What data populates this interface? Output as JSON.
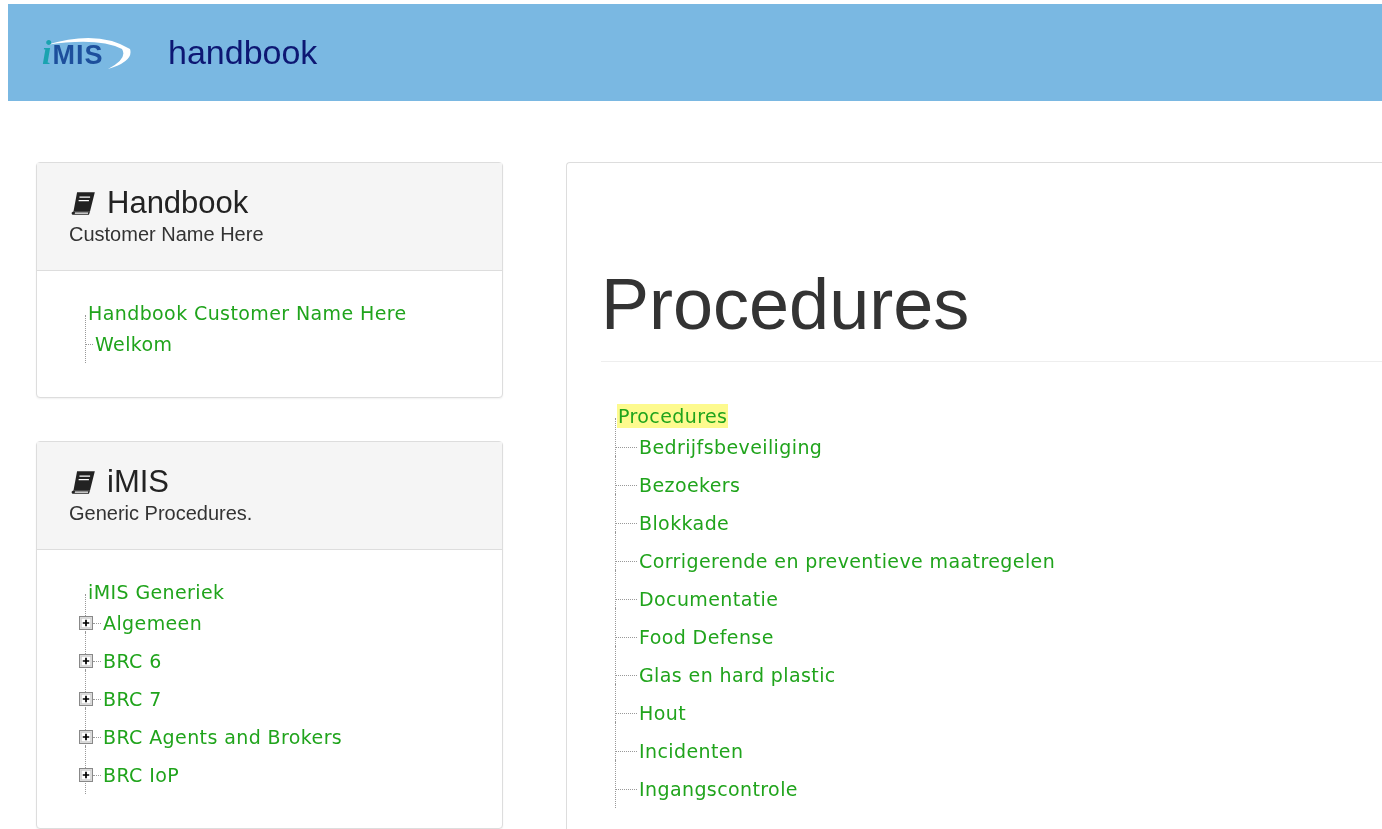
{
  "header": {
    "logo": "iMIS",
    "title": "handbook"
  },
  "panels": [
    {
      "title": "Handbook",
      "subtitle": "Customer Name Here",
      "tree": {
        "label": "Handbook Customer Name Here",
        "selected": false,
        "children": [
          {
            "label": "Welkom",
            "kind": "leaf",
            "selected": false
          }
        ]
      }
    },
    {
      "title": "iMIS",
      "subtitle": "Generic Procedures.",
      "tree": {
        "label": "iMIS Generiek",
        "selected": false,
        "children": [
          {
            "label": "Algemeen",
            "kind": "folder",
            "selected": false
          },
          {
            "label": "BRC 6",
            "kind": "folder",
            "selected": false
          },
          {
            "label": "BRC 7",
            "kind": "folder",
            "selected": false
          },
          {
            "label": "BRC Agents and Brokers",
            "kind": "folder",
            "selected": false
          },
          {
            "label": "BRC IoP",
            "kind": "folder",
            "selected": false
          }
        ]
      }
    }
  ],
  "main": {
    "heading": "Procedures",
    "tree": {
      "label": "Procedures",
      "selected": true,
      "children": [
        {
          "label": "Bedrijfsbeveiliging",
          "selected": false
        },
        {
          "label": "Bezoekers",
          "selected": false
        },
        {
          "label": "Blokkade",
          "selected": false
        },
        {
          "label": "Corrigerende en preventieve maatregelen",
          "selected": false
        },
        {
          "label": "Documentatie",
          "selected": false
        },
        {
          "label": "Food Defense",
          "selected": false
        },
        {
          "label": "Glas en hard plastic",
          "selected": false
        },
        {
          "label": "Hout",
          "selected": false
        },
        {
          "label": "Incidenten",
          "selected": false
        },
        {
          "label": "Ingangscontrole",
          "selected": false
        }
      ]
    }
  }
}
